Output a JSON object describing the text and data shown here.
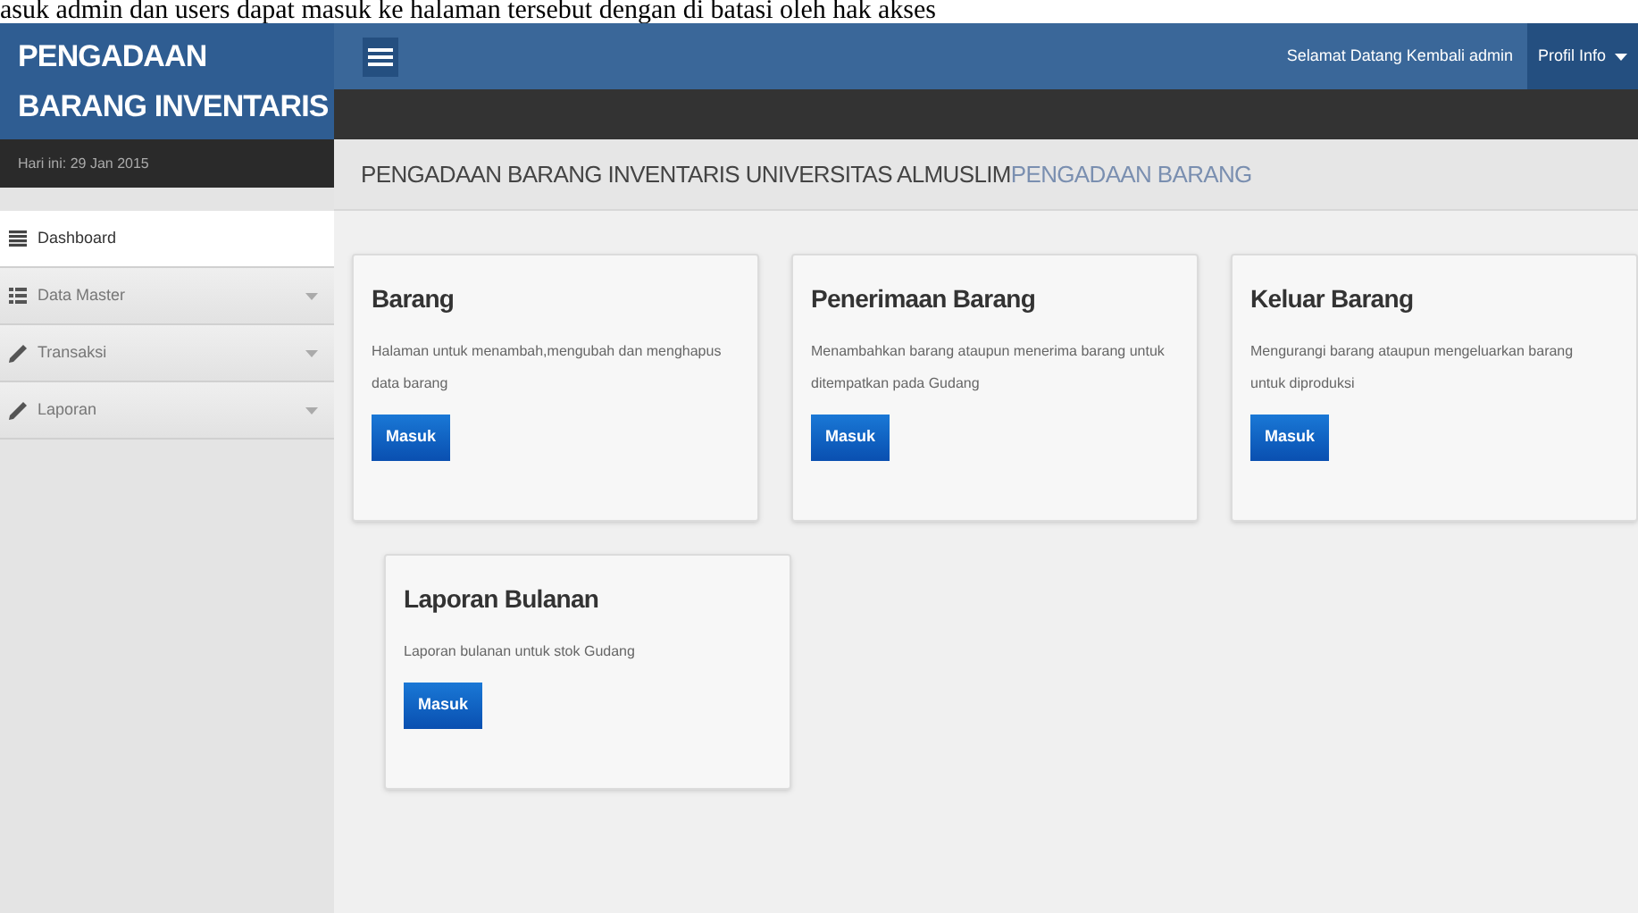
{
  "document_caption": "asuk admin dan users dapat masuk ke halaman tersebut dengan di batasi oleh hak akses",
  "brand": "PENGADAAN BARANG INVENTARIS",
  "date": "Hari ini: 29 Jan 2015",
  "sidebar": {
    "items": [
      {
        "label": "Dashboard",
        "kind": "lines",
        "selected": true,
        "has_submenu": false
      },
      {
        "label": "Data Master",
        "kind": "list",
        "selected": false,
        "has_submenu": true
      },
      {
        "label": "Transaksi",
        "kind": "pencil",
        "selected": false,
        "has_submenu": true
      },
      {
        "label": "Laporan",
        "kind": "pencil",
        "selected": false,
        "has_submenu": true
      }
    ]
  },
  "header": {
    "welcome": "Selamat Datang Kembali admin",
    "profile_button": "Profil Info"
  },
  "breadcrumb": {
    "title": "PENGADAAN BARANG INVENTARIS UNIVERSITAS ALMUSLIM",
    "current": "PENGADAAN BARANG"
  },
  "cards": [
    {
      "title": "Barang",
      "description": "Halaman untuk menambah,mengubah dan menghapus data barang",
      "button": "Masuk"
    },
    {
      "title": "Penerimaan Barang",
      "description": "Menambahkan barang ataupun menerima barang untuk ditempatkan pada Gudang",
      "button": "Masuk"
    },
    {
      "title": "Keluar Barang",
      "description": "Mengurangi barang ataupun mengeluarkan barang untuk diproduksi",
      "button": "Masuk"
    },
    {
      "title": "Laporan Bulanan",
      "description": "Laporan bulanan untuk stok Gudang",
      "button": "Masuk"
    }
  ]
}
